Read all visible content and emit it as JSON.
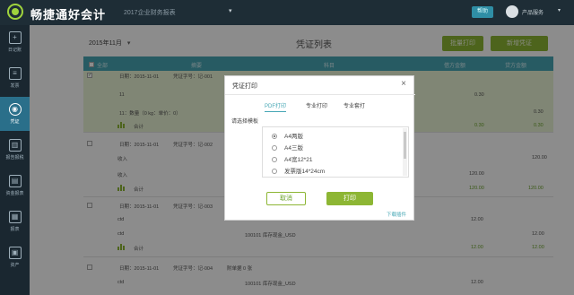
{
  "topbar": {
    "brand": "畅捷通好会计",
    "company": "2017企业财务报表",
    "center_button": "帮助",
    "user": "产品服务"
  },
  "sidebar": {
    "items": [
      {
        "icon": "plus-icon",
        "label": "日记账"
      },
      {
        "icon": "document-icon",
        "label": "发票"
      },
      {
        "icon": "eye-icon",
        "label": "凭证",
        "active": true
      },
      {
        "icon": "chart-icon",
        "label": "报告报税"
      },
      {
        "icon": "ledger-icon",
        "label": "资金报表"
      },
      {
        "icon": "grid-icon",
        "label": "报表"
      },
      {
        "icon": "box-icon",
        "label": "资产"
      }
    ]
  },
  "header": {
    "date": "2015年11月",
    "title": "凭证列表",
    "batch_print": "批量打印",
    "new_voucher": "新增凭证"
  },
  "table": {
    "headers": [
      "全部",
      "摘要",
      "科目",
      "借方金额",
      "贷方金额"
    ],
    "vouchers": [
      {
        "date": "日期：2015-11-01",
        "number": "凭证字号：记-001",
        "selected": true,
        "lines": [
          {
            "summary": "11",
            "account": "",
            "debit": "0.30",
            "credit": ""
          },
          {
            "summary": "11：数量（0 kg：单价：0）",
            "account": "",
            "debit": "",
            "credit": "0.30"
          }
        ],
        "total_label": "合计",
        "total_debit": "0.30",
        "total_credit": "0.30"
      },
      {
        "date": "日期：2015-11-01",
        "number": "凭证字号：记-002",
        "selected": false,
        "lines": [
          {
            "summary": "收入",
            "account": "",
            "debit": "",
            "credit": "120.00"
          },
          {
            "summary": "收入",
            "account": "",
            "debit": "120.00",
            "credit": ""
          }
        ],
        "total_label": "合计",
        "total_debit": "120.00",
        "total_credit": "120.00"
      },
      {
        "date": "日期：2015-11-01",
        "number": "凭证字号：记-003",
        "selected": false,
        "lines": [
          {
            "summary": "ctd",
            "account": "",
            "debit": "12.00",
            "credit": ""
          },
          {
            "summary": "ctd",
            "account": "100101 库存现金_USD",
            "debit": "",
            "credit": "12.00"
          }
        ],
        "total_label": "合计",
        "total_debit": "12.00",
        "total_credit": "12.00"
      },
      {
        "date": "日期：2015-11-01",
        "number": "凭证字号：记-004",
        "attach": "附单据 0 张",
        "selected": false,
        "lines": [
          {
            "summary": "ctd",
            "account": "100101 库存现金_USD",
            "debit": "12.00",
            "credit": ""
          }
        ]
      }
    ]
  },
  "modal": {
    "title": "凭证打印",
    "tabs": [
      "PDF打印",
      "专业打印",
      "专业套打"
    ],
    "choose_label": "请选择模板",
    "options": [
      "A4两版",
      "A4三版",
      "A4宽12*21",
      "发票版14*24cm"
    ],
    "selected_index": 0,
    "cancel": "取消",
    "print": "打印",
    "link": "下载插件"
  },
  "colors": {
    "topbar": "#1e2d36",
    "sidebar": "#1a2730",
    "accent_green": "#8db634",
    "table_header": "#47a7b5"
  }
}
